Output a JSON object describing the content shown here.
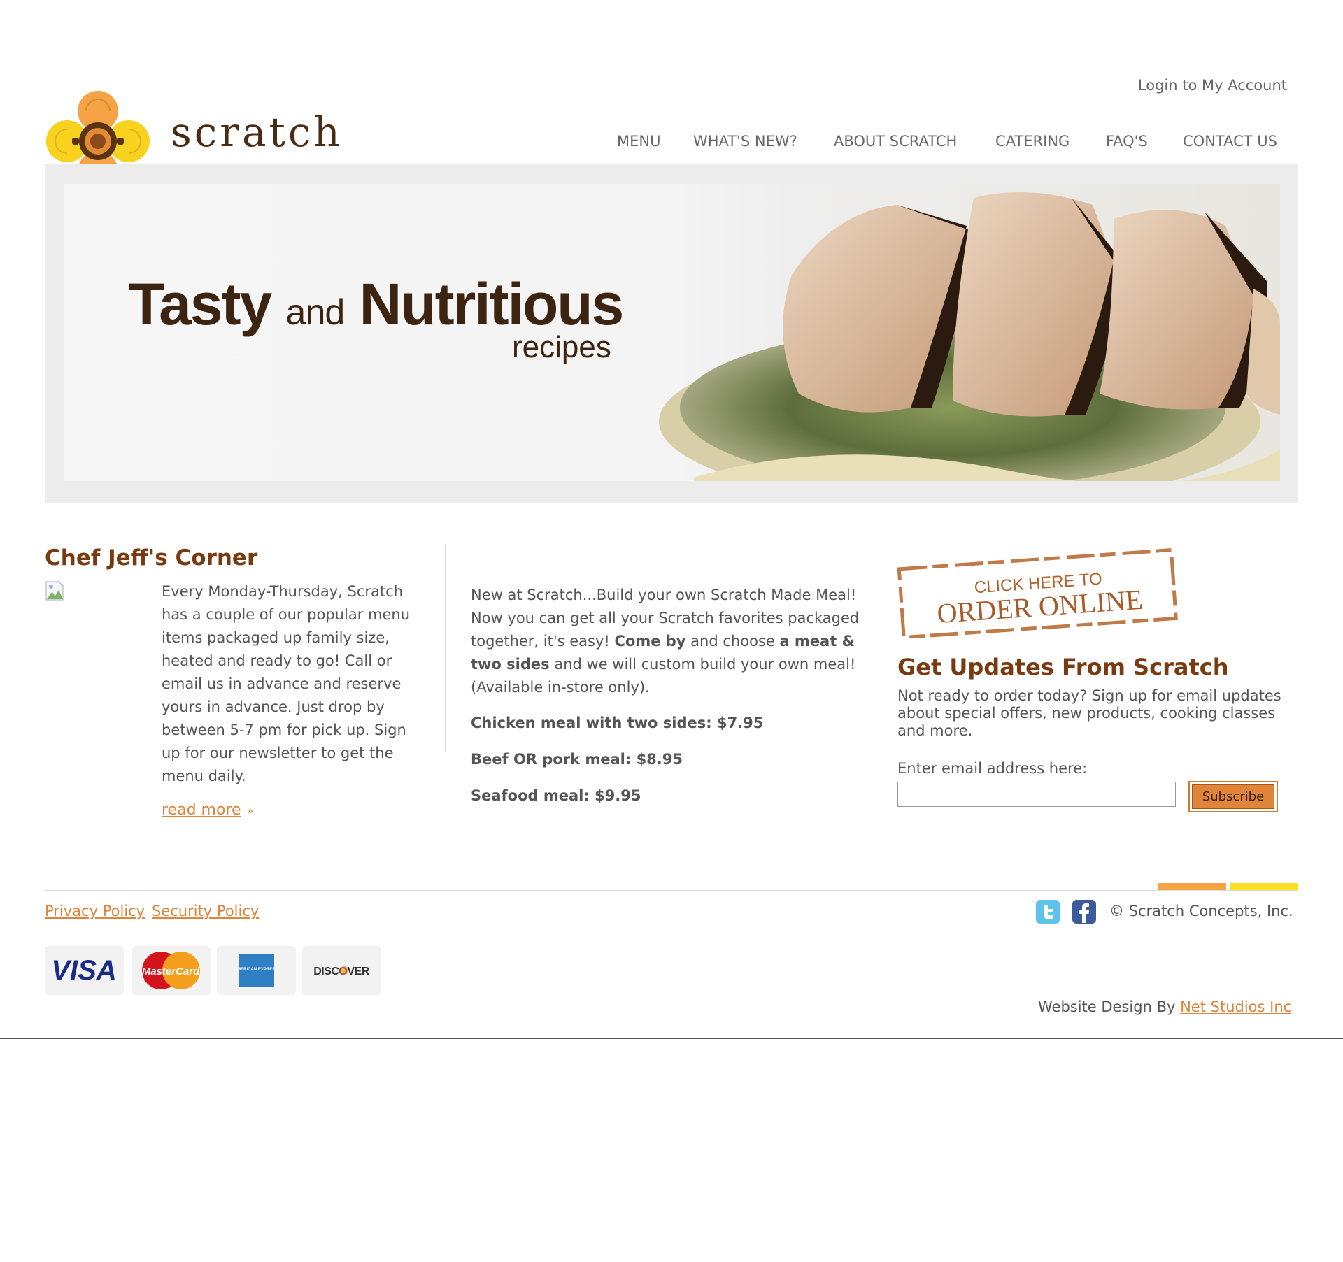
{
  "header": {
    "login_label": "Login to My Account",
    "logo_text": "scratch",
    "nav": [
      "MENU",
      "WHAT'S NEW?",
      "ABOUT SCRATCH",
      "CATERING",
      "FAQ'S",
      "CONTACT US"
    ]
  },
  "hero": {
    "title_part1": "Tasty",
    "title_and": "and",
    "title_part2": "Nutritious",
    "subtitle": "recipes"
  },
  "chef_corner": {
    "title": "Chef Jeff's Corner",
    "text": "Every Monday-Thursday, Scratch has a couple of our popular menu items packaged up family size, heated and ready to go! Call or email us in advance and reserve yours in advance. Just drop by between 5-7 pm for pick up. Sign up for our newsletter to get the menu daily.",
    "read_more": "read more"
  },
  "build_meal": {
    "intro_1": "New at Scratch...Build your own Scratch Made Meal! Now you can get all your Scratch favorites packaged together, it's easy! ",
    "intro_bold_1": "Come by",
    "intro_2": " and choose ",
    "intro_bold_2": "a meat & two sides",
    "intro_3": " and we will custom build your own meal! (Available in-store only).",
    "prices": [
      "Chicken meal with two sides: $7.95",
      "Beef OR pork meal: $8.95",
      "Seafood meal: $9.95"
    ]
  },
  "order_online": {
    "line1": "CLICK HERE TO",
    "line2": "ORDER ONLINE"
  },
  "updates": {
    "title": "Get Updates From Scratch",
    "text": "Not ready to order today? Sign up for email updates about special offers, new products, cooking classes and more.",
    "email_label": "Enter email address here:",
    "email_value": "",
    "subscribe_label": "Subscribe"
  },
  "footer": {
    "privacy_label": "Privacy Policy",
    "security_label": "Security Policy",
    "copyright": "© Scratch Concepts, Inc.",
    "design_prefix": "Website Design By ",
    "design_link": "Net Studios Inc",
    "cards": [
      "VISA",
      "MasterCard",
      "AMERICAN EXPRESS",
      "DISCOVER"
    ]
  },
  "colors": {
    "brand_brown": "#7a3a0f",
    "accent_orange": "#e0843a",
    "footer_orange": "#f5a345",
    "footer_yellow": "#f8df1f"
  },
  "icons": [
    "broken-image-icon",
    "chevron-double-right-icon",
    "twitter-icon",
    "facebook-icon",
    "visa-logo",
    "mastercard-logo",
    "amex-logo",
    "discover-logo",
    "scratch-flower-logo"
  ]
}
